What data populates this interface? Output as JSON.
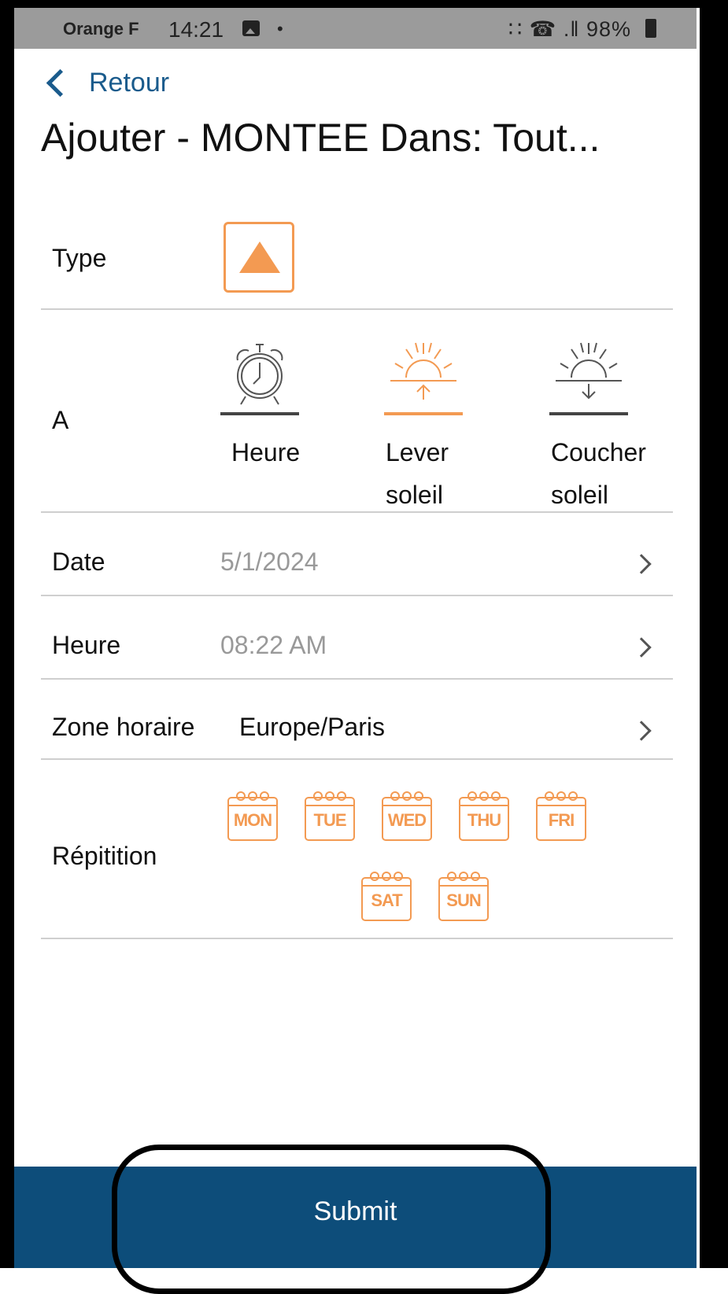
{
  "status_bar": {
    "carrier": "Orange F",
    "time": "14:21",
    "dot": "•",
    "right": "∷ ☎ .‖ 98%"
  },
  "header": {
    "back_label": "Retour",
    "title": "Ajouter -  MONTEE  Dans:  Tout..."
  },
  "rows": {
    "type": {
      "label": "Type",
      "icon": "triangle-up-icon",
      "color": "#f39a52"
    },
    "a": {
      "label": "A",
      "options": [
        {
          "label_line1": "Heure",
          "label_line2": "",
          "icon": "alarm-clock-icon",
          "selected": false
        },
        {
          "label_line1": "Lever",
          "label_line2": "soleil",
          "icon": "sunrise-icon",
          "selected": true
        },
        {
          "label_line1": "Coucher",
          "label_line2": "soleil",
          "icon": "sunset-icon",
          "selected": false
        }
      ]
    },
    "date": {
      "label": "Date",
      "value": "5/1/2024"
    },
    "heure": {
      "label": "Heure",
      "value": "08:22 AM"
    },
    "zone": {
      "label": "Zone horaire",
      "value": "Europe/Paris"
    },
    "repetition": {
      "label": "Répitition",
      "days": [
        "MON",
        "TUE",
        "WED",
        "THU",
        "FRI",
        "SAT",
        "SUN"
      ]
    }
  },
  "submit": {
    "label": "Submit"
  },
  "colors": {
    "accent": "#f39a52",
    "primary": "#0d4d7a",
    "link": "#1a5b8c"
  }
}
